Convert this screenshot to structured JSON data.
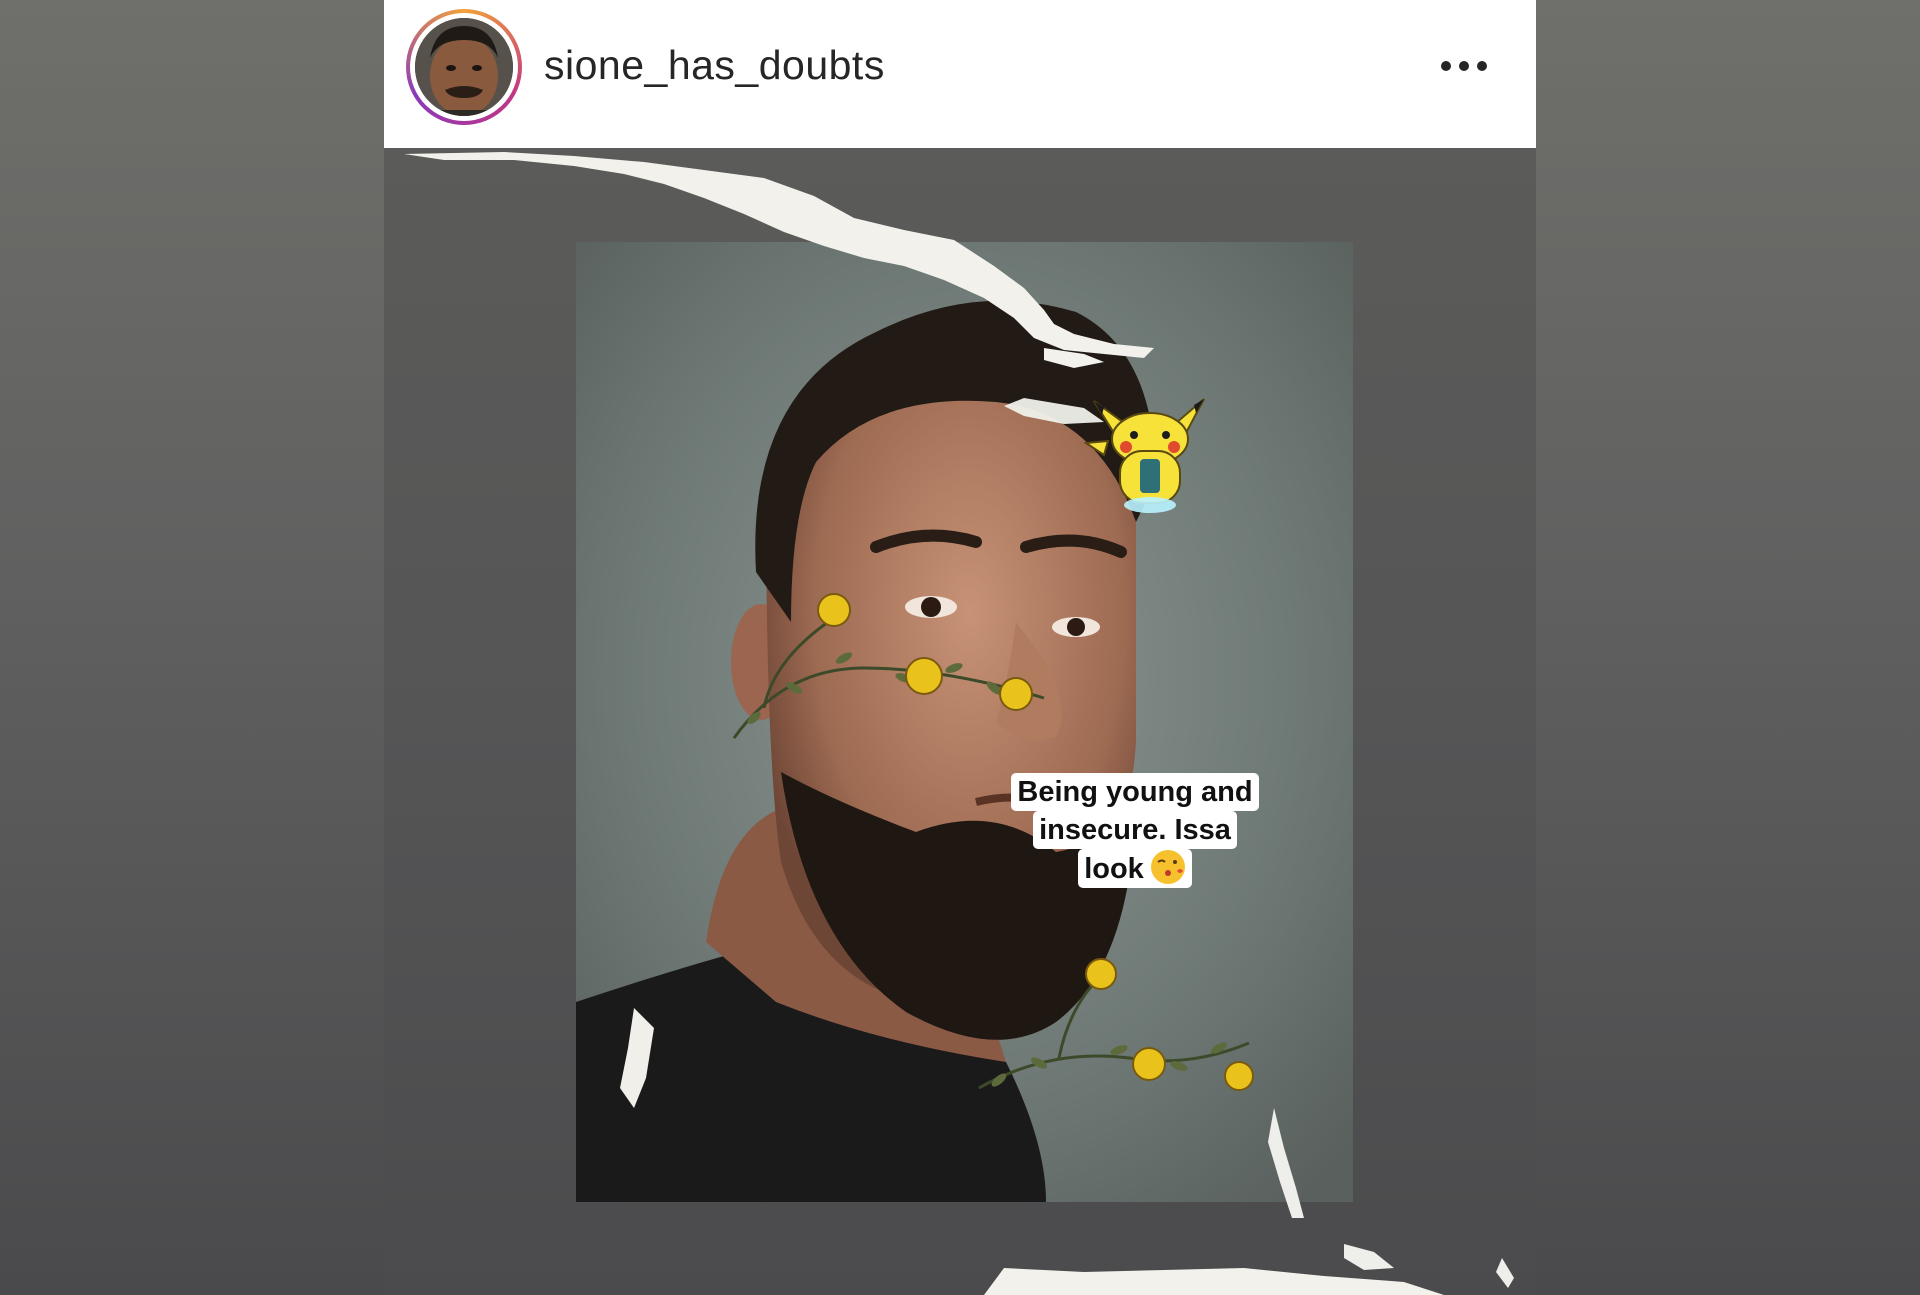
{
  "post": {
    "username": "sione_has_doubts",
    "more_icon": "more-horizontal-icon",
    "caption_lines": [
      "Being young and",
      "insecure. Issa",
      "look"
    ],
    "caption_emoji": "kissing-face-emoji"
  },
  "colors": {
    "header_bg": "#ffffff",
    "username_text": "#262626",
    "story_ring": [
      "#f2a23a",
      "#c13584",
      "#8a3ab9"
    ],
    "background": "#606060",
    "sticker_yellow": "#f7e23a"
  }
}
